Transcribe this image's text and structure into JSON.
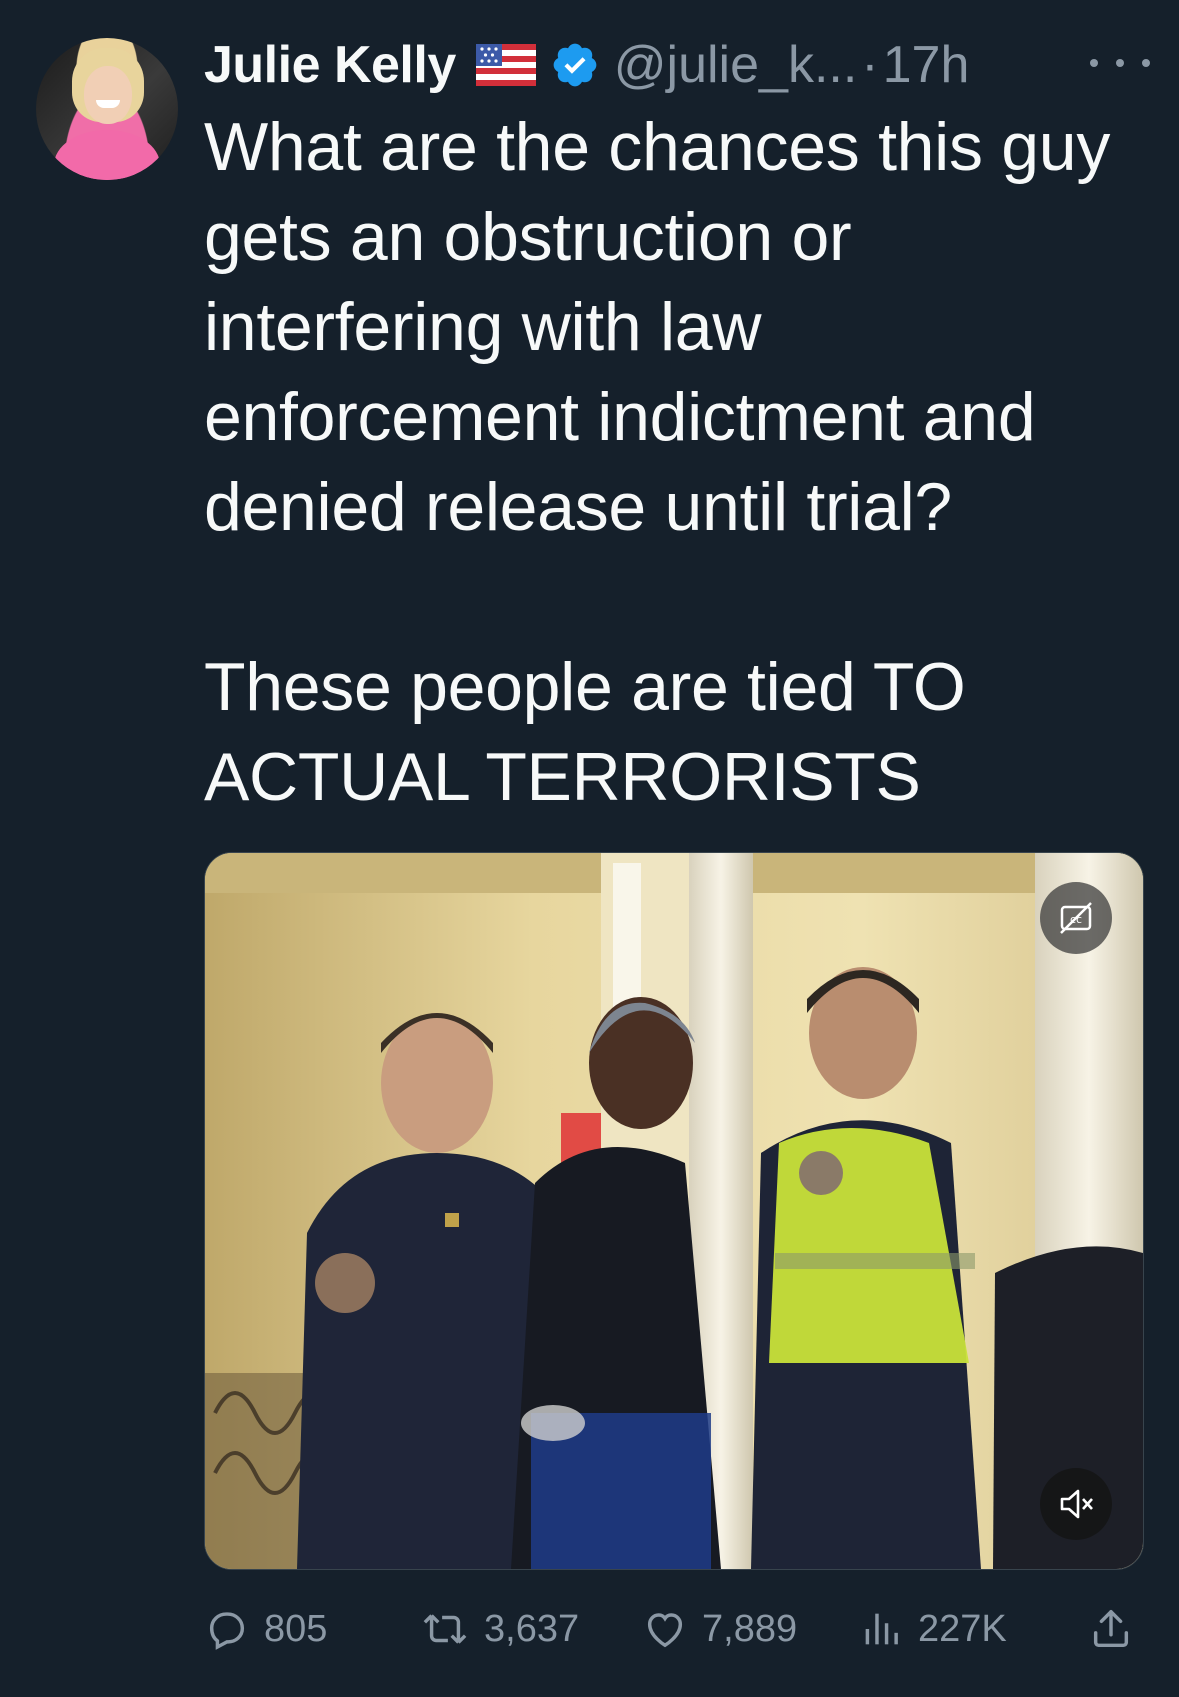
{
  "author": {
    "name": "Julie Kelly",
    "handle": "@julie_k...",
    "separator": "·",
    "time": "17h"
  },
  "tweet": {
    "paragraph1": "What are the chances this guy gets an obstruction or interfering with law enforcement indictment and denied release until trial?",
    "paragraph2": "These people are tied TO ACTUAL TERRORISTS"
  },
  "icons": {
    "flag": "us-flag-icon",
    "verified": "verified-badge-icon",
    "more": "more-options-icon",
    "captions": "captions-off-icon",
    "mute": "muted-speaker-icon",
    "reply": "reply-icon",
    "retweet": "retweet-icon",
    "like": "heart-icon",
    "views": "views-icon",
    "share": "share-icon"
  },
  "metrics": {
    "replies": "805",
    "retweets": "3,637",
    "likes": "7,889",
    "views": "227K"
  },
  "colors": {
    "background": "#15202b",
    "text": "#f7f9f9",
    "secondary": "#8b98a5",
    "verified": "#1d9bf0"
  }
}
